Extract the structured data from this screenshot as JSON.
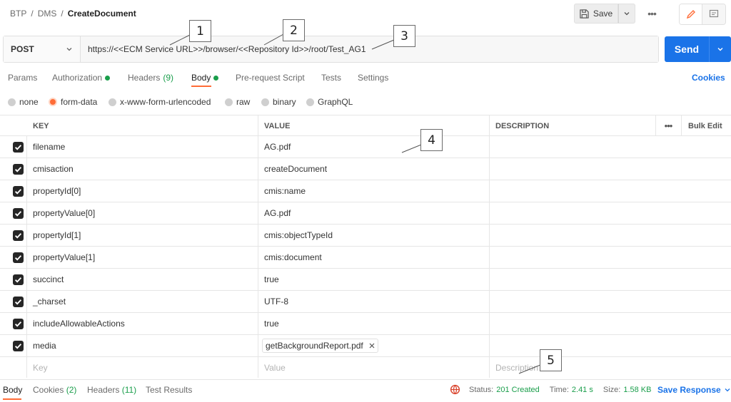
{
  "header": {
    "breadcrumb": [
      "BTP",
      "DMS",
      "CreateDocument"
    ],
    "separator": "/",
    "save_label": "Save"
  },
  "request": {
    "method": "POST",
    "url": "https://<<ECM Service URL>>/browser/<<Repository Id>>/root/Test_AG1",
    "send_label": "Send"
  },
  "tabs": [
    {
      "label": "Params",
      "count": "",
      "dot": false
    },
    {
      "label": "Authorization",
      "count": "",
      "dot": true
    },
    {
      "label": "Headers",
      "count": "(9)",
      "dot": false
    },
    {
      "label": "Body",
      "count": "",
      "dot": true
    },
    {
      "label": "Pre-request Script",
      "count": "",
      "dot": false
    },
    {
      "label": "Tests",
      "count": "",
      "dot": false
    },
    {
      "label": "Settings",
      "count": "",
      "dot": false
    }
  ],
  "cookies_label": "Cookies",
  "body_types": [
    "none",
    "form-data",
    "x-www-form-urlencoded",
    "raw",
    "binary",
    "GraphQL"
  ],
  "table": {
    "headers": {
      "key": "KEY",
      "value": "VALUE",
      "description": "DESCRIPTION",
      "bulk_edit": "Bulk Edit"
    },
    "rows": [
      {
        "key": "filename",
        "value": "AG.pdf"
      },
      {
        "key": "cmisaction",
        "value": "createDocument"
      },
      {
        "key": "propertyId[0]",
        "value": "cmis:name"
      },
      {
        "key": "propertyValue[0]",
        "value": "AG.pdf"
      },
      {
        "key": "propertyId[1]",
        "value": "cmis:objectTypeId"
      },
      {
        "key": "propertyValue[1]",
        "value": "cmis:document"
      },
      {
        "key": "succinct",
        "value": "true"
      },
      {
        "key": "_charset",
        "value": "UTF-8"
      },
      {
        "key": "includeAllowableActions",
        "value": "true"
      },
      {
        "key": "media",
        "value": "getBackgroundReport.pdf"
      }
    ],
    "placeholders": {
      "key": "Key",
      "value": "Value",
      "description": "Description"
    }
  },
  "footer": {
    "tabs": [
      {
        "label": "Body",
        "count": ""
      },
      {
        "label": "Cookies",
        "count": "(2)"
      },
      {
        "label": "Headers",
        "count": "(11)"
      },
      {
        "label": "Test Results",
        "count": ""
      }
    ],
    "status_label": "Status:",
    "status_value": "201 Created",
    "time_label": "Time:",
    "time_value": "2.41 s",
    "size_label": "Size:",
    "size_value": "1.58 KB",
    "save_response_label": "Save Response"
  },
  "callouts": [
    "1",
    "2",
    "3",
    "4",
    "5"
  ],
  "colors": {
    "accent": "#ff6c37",
    "primary": "#1a73e8",
    "success": "#1a9e4b"
  },
  "icons": [
    "save-icon",
    "chevron-down-icon",
    "more-icon",
    "pencil-icon",
    "comment-icon",
    "globe-icon",
    "close-icon"
  ]
}
